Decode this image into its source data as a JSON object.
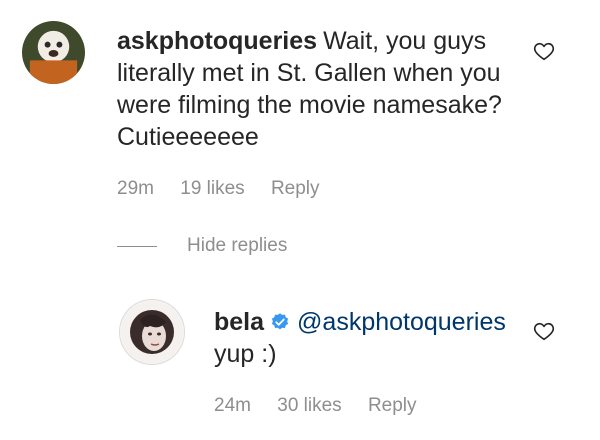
{
  "comment": {
    "username": "askphotoqueries",
    "text": "Wait, you guys literally met in St. Gallen when you were filming the movie namesake? Cutieeeeeee",
    "time": "29m",
    "likes": "19 likes",
    "reply_label": "Reply",
    "avatar_icon": "dog-avatar",
    "like_icon": "heart-outline-icon"
  },
  "hide_replies_label": "Hide replies",
  "reply": {
    "username": "bela",
    "verified_icon": "verified-badge-icon",
    "mention": "@askphotoqueries",
    "text": "yup :)",
    "time": "24m",
    "likes": "30 likes",
    "reply_label": "Reply",
    "avatar_icon": "woman-avatar",
    "like_icon": "heart-outline-icon"
  },
  "colors": {
    "text": "#262626",
    "secondary": "#8e8e8e",
    "mention": "#00376b",
    "verified": "#3897f0"
  }
}
